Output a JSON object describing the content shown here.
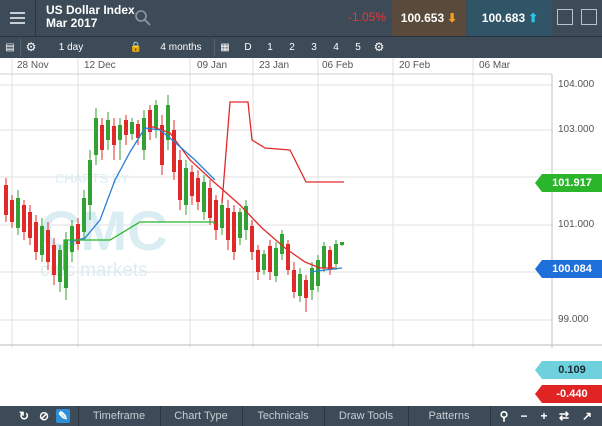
{
  "header": {
    "instrument_name": "US Dollar Index",
    "instrument_expiry": "Mar 2017",
    "change": "-1.05%",
    "sell_price": "100.653",
    "buy_price": "100.683"
  },
  "toolbar": {
    "interval": "1 day",
    "range": "4 months",
    "range_buttons": [
      "D",
      "1",
      "2",
      "3",
      "4",
      "5"
    ]
  },
  "chart": {
    "date_labels": [
      "28 Nov",
      "12 Dec",
      "09 Jan",
      "23 Jan",
      "06 Feb",
      "20 Feb",
      "06 Mar"
    ],
    "price_labels": [
      "104.000",
      "103.000",
      "101.000",
      "99.000"
    ],
    "tags": {
      "upper_line": "101.917",
      "last_price": "100.084",
      "macd_hist": "0.109",
      "macd_value": "-0.440"
    },
    "watermark": {
      "line1": "CHARTS BY",
      "line2": "CMC",
      "line3": "cmc markets"
    },
    "colors": {
      "up": "#33a133",
      "down": "#e02a2a",
      "blue": "#2a7fd4",
      "red": "#e02a2a",
      "green": "#2bb52b"
    }
  },
  "bottom": {
    "tabs": [
      "Timeframe",
      "Chart Type",
      "Technicals",
      "Draw Tools",
      "Patterns"
    ]
  }
}
